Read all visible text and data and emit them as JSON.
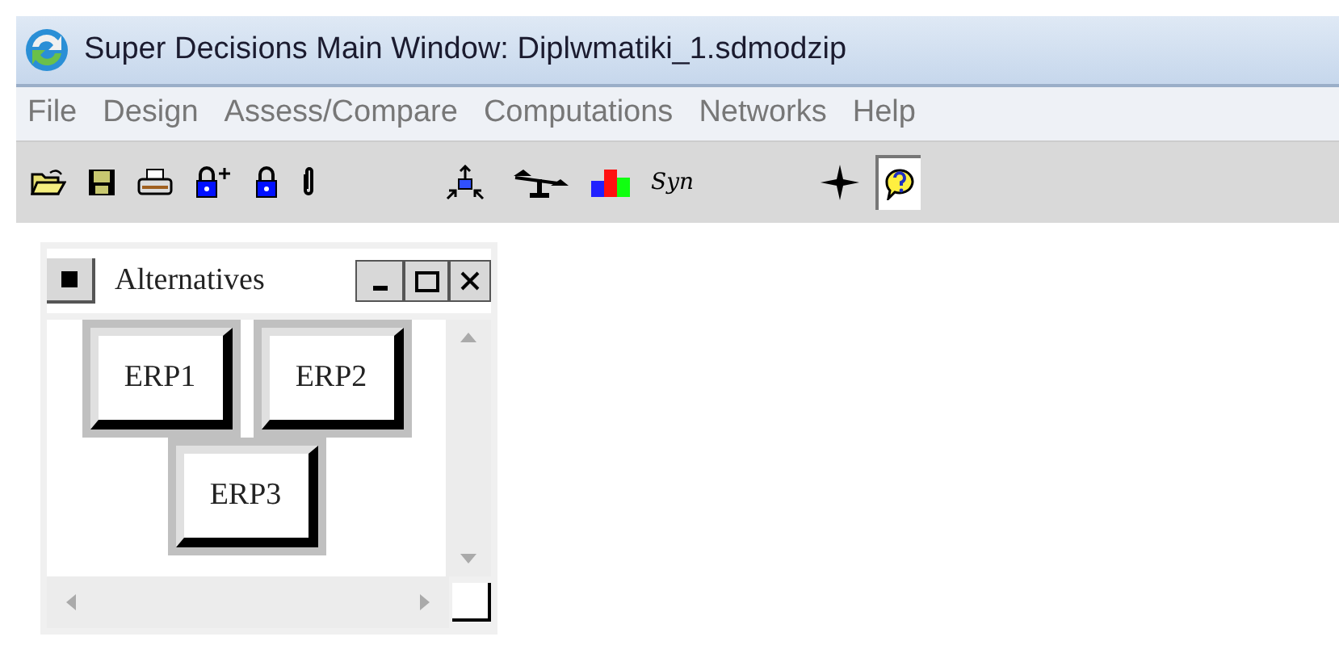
{
  "window": {
    "title": "Super Decisions Main Window: Diplwmatiki_1.sdmodzip"
  },
  "menu": [
    "File",
    "Design",
    "Assess/Compare",
    "Computations",
    "Networks",
    "Help"
  ],
  "toolbar": [
    {
      "kind": "open",
      "pressed": false
    },
    {
      "kind": "save",
      "pressed": false
    },
    {
      "kind": "print",
      "pressed": false
    },
    {
      "kind": "lock-plus",
      "pressed": false
    },
    {
      "kind": "lock",
      "pressed": false
    },
    {
      "kind": "clip",
      "pressed": false
    },
    {
      "kind": "gap"
    },
    {
      "kind": "network",
      "pressed": false
    },
    {
      "kind": "scale",
      "pressed": false
    },
    {
      "kind": "bars",
      "pressed": false
    },
    {
      "kind": "text",
      "label": "Syn",
      "pressed": false
    },
    {
      "kind": "gap"
    },
    {
      "kind": "compass",
      "pressed": false
    },
    {
      "kind": "help",
      "pressed": true
    }
  ],
  "cluster": {
    "title": "Alternatives",
    "nodes": [
      "ERP1",
      "ERP2",
      "ERP3"
    ]
  }
}
